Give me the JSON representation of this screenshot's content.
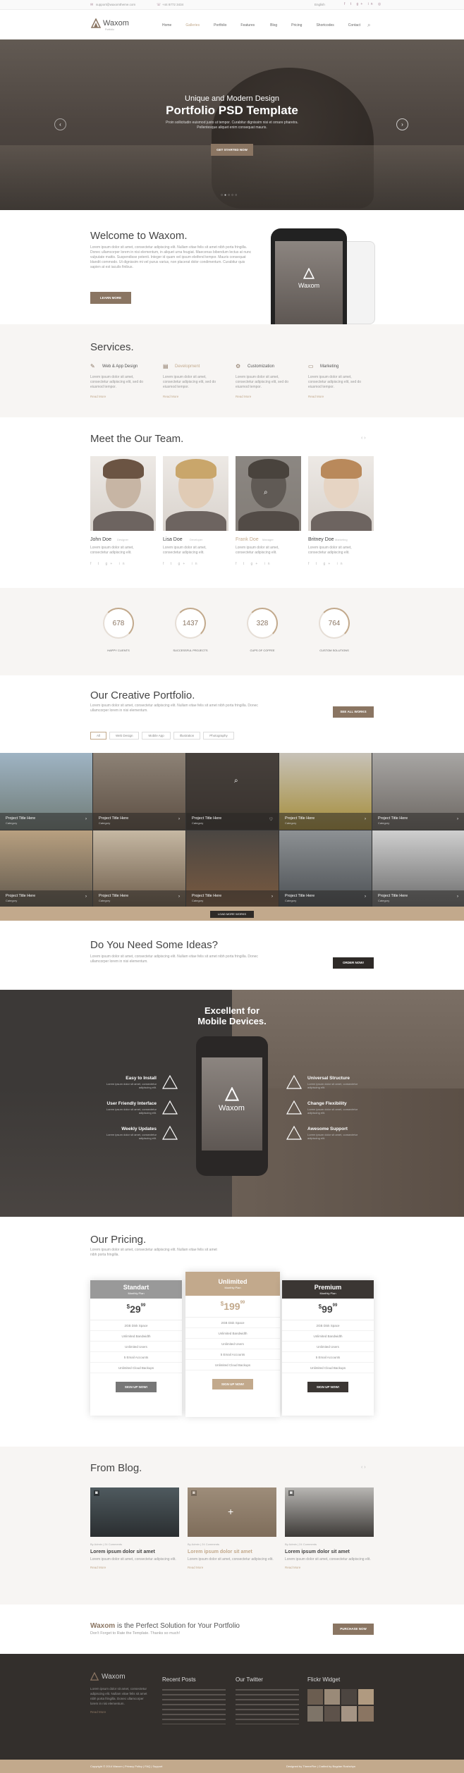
{
  "topbar": {
    "email": "support@waxomtheme.com",
    "phone": "+44 8772 3434",
    "lang": "English"
  },
  "nav": {
    "logo": "Waxom",
    "tagline": "Portfolio",
    "items": [
      "Home",
      "Galleries",
      "Portfolio",
      "Features",
      "Blog",
      "Pricing",
      "Shortcodes",
      "Contact"
    ]
  },
  "hero": {
    "subtitle": "Unique and Modern Design",
    "title": "Portfolio PSD Template",
    "text": "Proin sollicitudin euismod justo ut tempor. Curabitur dignissim nisi et ornare pharetra. Pellentesque aliquet enim consequat mauris.",
    "button": "GET STARTED NOW"
  },
  "welcome": {
    "title": "Welcome to Waxom.",
    "text": "Lorem ipsum dolor sit amet, consectetur adipiscing elit. Nullam vitae felis sit amet nibh porta fringilla. Donec ullamcorper lorem in nisi elementum, in aliquet urna feugiat. Maecenas bibendum lectus at nunc vulputate mattis. Suspendisse potenti. Integer id quam vel ipsum eleifend tempor. Mauris consequat blandit commodo. Ut dignissim mi vel purus varius, non placerat dolor condimentum. Curabitur quis sapien at est iaculis finibus.",
    "button": "LEARN MORE",
    "phone_logo": "Waxom"
  },
  "services": {
    "title": "Services.",
    "items": [
      {
        "name": "Web & App Design",
        "text": "Lorem ipsum dolor sit amet, consectetur adipiscing elit, sed do eiusmod tempor.",
        "more": "Read More"
      },
      {
        "name": "Development",
        "text": "Lorem ipsum dolor sit amet, consectetur adipiscing elit, sed do eiusmod tempor.",
        "more": "Read More"
      },
      {
        "name": "Customization",
        "text": "Lorem ipsum dolor sit amet, consectetur adipiscing elit, sed do eiusmod tempor.",
        "more": "Read More"
      },
      {
        "name": "Marketing",
        "text": "Lorem ipsum dolor sit amet, consectetur adipiscing elit, sed do eiusmod tempor.",
        "more": "Read More"
      }
    ]
  },
  "team": {
    "title": "Meet the Our Team.",
    "members": [
      {
        "name": "John Doe",
        "role": "Designer",
        "text": "Lorem ipsum dolor sit amet, consectetur adipiscing elit."
      },
      {
        "name": "Lisa Doe",
        "role": "Developer",
        "text": "Lorem ipsum dolor sit amet, consectetur adipiscing elit."
      },
      {
        "name": "Frank Doe",
        "role": "Manager",
        "text": "Lorem ipsum dolor sit amet, consectetur adipiscing elit."
      },
      {
        "name": "Britney Doe",
        "role": "Marketing",
        "text": "Lorem ipsum dolor sit amet, consectetur adipiscing elit."
      }
    ]
  },
  "stats": [
    {
      "value": "678",
      "label": "HAPPY CLIENTS"
    },
    {
      "value": "1437",
      "label": "SUCCESSFUL PROJECTS"
    },
    {
      "value": "328",
      "label": "CUPS OF COFFEE"
    },
    {
      "value": "764",
      "label": "CUSTOM SOLUTIONS"
    }
  ],
  "portfolio": {
    "title": "Our Creative Portfolio.",
    "text": "Lorem ipsum dolor sit amet, consectetur adipiscing elit. Nullam vitae felis sit amet nibh porta fringilla. Donec ullamcorper lorem in nisi elementum.",
    "button": "SEE ALL WORKS",
    "filters": [
      "All",
      "Web Design",
      "Mobile App",
      "Illustration",
      "Photography"
    ],
    "item_title": "Project Title Here",
    "item_cat": "Category",
    "load_more": "LOAD MORE WORKS"
  },
  "ideas": {
    "title": "Do You Need Some Ideas?",
    "text": "Lorem ipsum dolor sit amet, consectetur adipiscing elit. Nullam vitae felis sit amet nibh porta fringilla. Donec ullamcorper lorem in nisi elementum.",
    "button": "ORDER NOW!"
  },
  "devices": {
    "title1": "Excellent for",
    "title2": "Mobile Devices.",
    "phone_logo": "Waxom",
    "left": [
      {
        "title": "Easy to Install",
        "text": "Lorem ipsum dolor sit amet, consectetur adipiscing elit."
      },
      {
        "title": "User Friendly Interface",
        "text": "Lorem ipsum dolor sit amet, consectetur adipiscing elit."
      },
      {
        "title": "Weekly Updates",
        "text": "Lorem ipsum dolor sit amet, consectetur adipiscing elit."
      }
    ],
    "right": [
      {
        "title": "Universal Structure",
        "text": "Lorem ipsum dolor sit amet, consectetur adipiscing elit."
      },
      {
        "title": "Change Flexibility",
        "text": "Lorem ipsum dolor sit amet, consectetur adipiscing elit."
      },
      {
        "title": "Awesome Support",
        "text": "Lorem ipsum dolor sit amet, consectetur adipiscing elit."
      }
    ]
  },
  "pricing": {
    "title": "Our Pricing.",
    "text": "Lorem ipsum dolor sit amet, consectetur adipiscing elit. Nullam vitae felis sit amet nibh porta fringilla.",
    "plans": [
      {
        "name": "Standart",
        "period": "Monthly Plan",
        "price": "29",
        "cents": "99"
      },
      {
        "name": "Unlimited",
        "period": "Monthly Plan",
        "price": "199",
        "cents": "99"
      },
      {
        "name": "Premium",
        "period": "Monthly Plan",
        "price": "99",
        "cents": "99"
      }
    ],
    "features": [
      "2GB Disk Space",
      "Unlimited Bandwidth",
      "Unlimited Users",
      "5 Email Accounts",
      "Unlimited Cloud Backups"
    ],
    "button": "SIGN UP NOW!"
  },
  "blog": {
    "title": "From Blog.",
    "posts": [
      {
        "meta": "By Admin   |   24 Comments",
        "title": "Lorem ipsum dolor sit amet",
        "text": "Lorem ipsum dolor sit amet, consectetur adipiscing elit.",
        "more": "Read More"
      },
      {
        "meta": "By Admin   |   24 Comments",
        "title": "Lorem ipsum dolor sit amet",
        "text": "Lorem ipsum dolor sit amet, consectetur adipiscing elit.",
        "more": "Read More"
      },
      {
        "meta": "By Admin   |   24 Comments",
        "title": "Lorem ipsum dolor sit amet",
        "text": "Lorem ipsum dolor sit amet, consectetur adipiscing elit.",
        "more": "Read More"
      }
    ]
  },
  "cta": {
    "brand": "Waxom",
    "title": " is the Perfect Solution for Your Portfolio",
    "sub": "Don't Forget to Rate the Template. Thanks so much!",
    "button": "PURCHASE NOW"
  },
  "footer": {
    "logo": "Waxom",
    "about": "Lorem ipsum dolor sit amet, consectetur adipiscing elit. Nullam vitae felis sit amet nibh porta fringilla. Donec ullamcorper lorem in nisi elementum.",
    "more": "Read More",
    "recent": "Recent Posts",
    "twitter": "Our Twitter",
    "flickr": "Flickr Widget",
    "copyright": "Copyright © 2014 Waxom  |  Privacy Policy  |  FAQ  |  Support",
    "credit": "Designed by ThemeFire  |  Crafted by Bogdan Roshchyn"
  },
  "colors": {
    "accent": "#8a7562",
    "dark": "#3b3633",
    "gold": "#c2a98c"
  }
}
